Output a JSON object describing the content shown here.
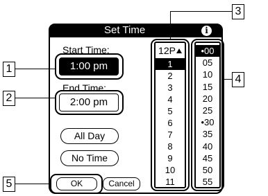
{
  "dialog": {
    "title": "Set Time",
    "info_icon": "info-icon",
    "start_label": "Start Time:",
    "start_value": "1:00 pm",
    "end_label": "End Time:",
    "end_value": "2:00 pm",
    "all_day_label": "All Day",
    "no_time_label": "No Time",
    "ok_label": "OK",
    "cancel_label": "Cancel"
  },
  "hours": {
    "header": "12P",
    "header_icon": "up-arrow-icon",
    "items": [
      "1",
      "2",
      "3",
      "4",
      "5",
      "6",
      "7",
      "8",
      "9",
      "10",
      "11"
    ],
    "selected": "1"
  },
  "minutes": {
    "items": [
      "•00",
      "05",
      "10",
      "15",
      "20",
      "25",
      "•30",
      "35",
      "40",
      "45",
      "50",
      "55"
    ],
    "selected": "•00"
  },
  "callouts": [
    "1",
    "2",
    "3",
    "4",
    "5"
  ]
}
